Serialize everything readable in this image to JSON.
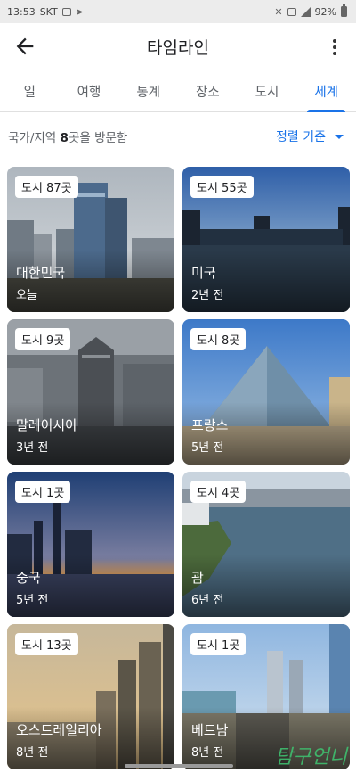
{
  "status_bar": {
    "time": "13:53",
    "carrier": "SKT",
    "battery": "92%"
  },
  "app_bar": {
    "title": "타임라인"
  },
  "tabs": [
    {
      "label": "일",
      "active": false
    },
    {
      "label": "여행",
      "active": false
    },
    {
      "label": "통계",
      "active": false
    },
    {
      "label": "장소",
      "active": false
    },
    {
      "label": "도시",
      "active": false
    },
    {
      "label": "세계",
      "active": true
    }
  ],
  "summary": {
    "prefix": "국가/지역 ",
    "count": "8",
    "suffix": "곳을 방문함",
    "sort_label": "정렬 기준"
  },
  "countries": [
    {
      "badge": "도시 87곳",
      "name": "대한민국",
      "time": "오늘"
    },
    {
      "badge": "도시 55곳",
      "name": "미국",
      "time": "2년 전"
    },
    {
      "badge": "도시 9곳",
      "name": "말레이시아",
      "time": "3년 전"
    },
    {
      "badge": "도시 8곳",
      "name": "프랑스",
      "time": "5년 전"
    },
    {
      "badge": "도시 1곳",
      "name": "중국",
      "time": "5년 전"
    },
    {
      "badge": "도시 4곳",
      "name": "괌",
      "time": "6년 전"
    },
    {
      "badge": "도시 13곳",
      "name": "오스트레일리아",
      "time": "8년 전"
    },
    {
      "badge": "도시 1곳",
      "name": "베트남",
      "time": "8년 전"
    }
  ],
  "watermark": "탐구언니",
  "colors": {
    "accent": "#1a73e8",
    "watermark": "#3fbf6f"
  }
}
